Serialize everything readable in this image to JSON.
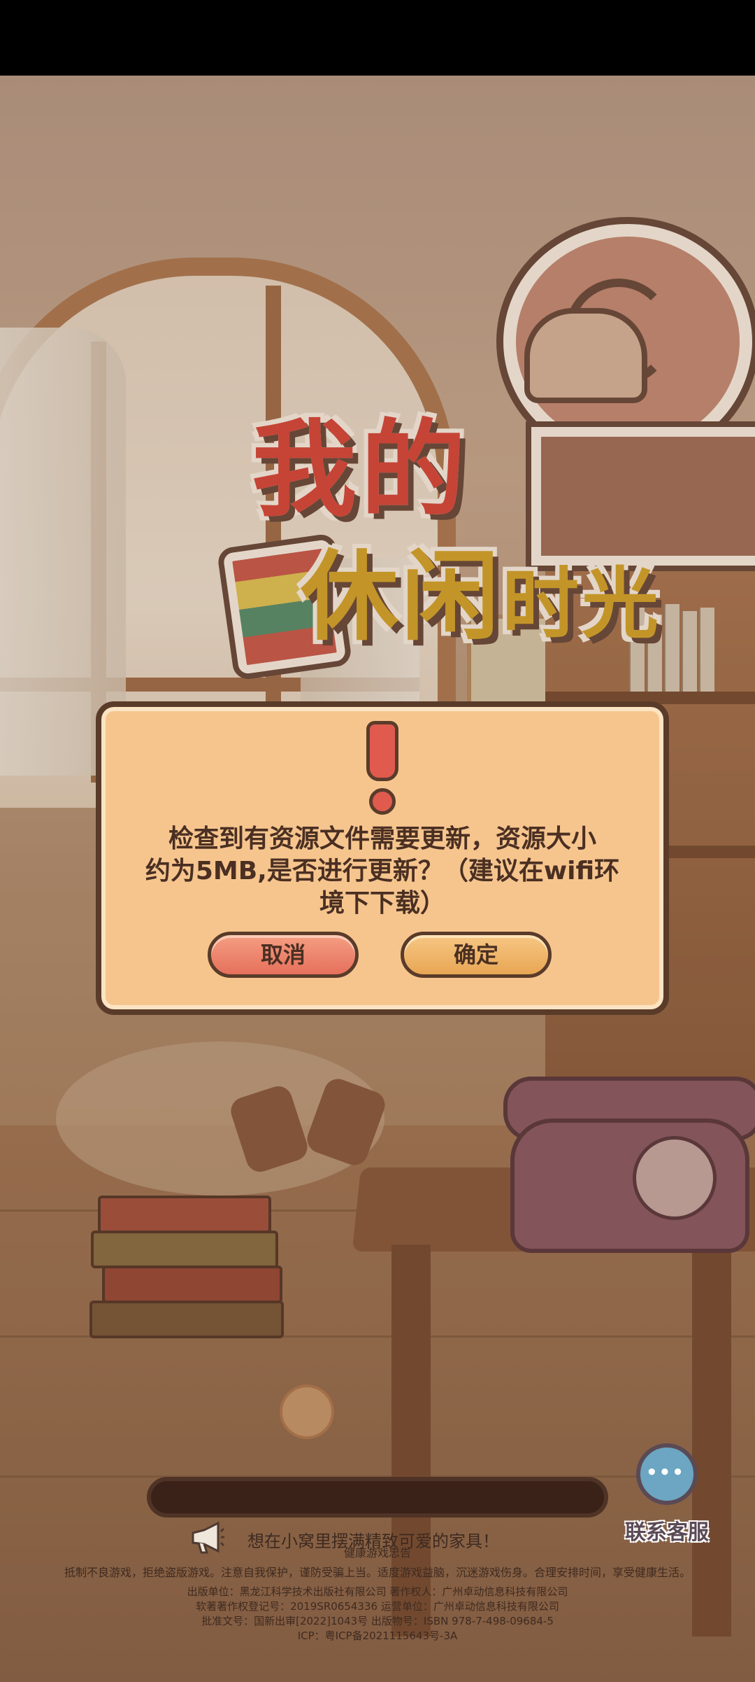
{
  "logo": {
    "line1": "我的",
    "line2a": "休闲",
    "line2b": "时光"
  },
  "dialog": {
    "message_line1": "检查到有资源文件需要更新，资源大小",
    "message_line2": "约为5MB,是否进行更新？（建议在wifi环",
    "message_line3": "境下下载）",
    "cancel_label": "取消",
    "ok_label": "确定",
    "icon": "exclamation-icon"
  },
  "loading": {
    "progress": 0.0,
    "tip": "想在小窝里摆满精致可爱的家具！",
    "tip_icon": "megaphone-icon"
  },
  "support": {
    "label": "联系客服",
    "icon": "customer-service-icon"
  },
  "footer": {
    "title": "健康游戏忠告",
    "advice": "抵制不良游戏，拒绝盗版游戏。注意自我保护，谨防受骗上当。适度游戏益脑，沉迷游戏伤身。合理安排时间，享受健康生活。",
    "publisher": "出版单位：黑龙江科学技术出版社有限公司    著作权人：广州卓动信息科技有限公司",
    "copyright": "软著著作权登记号：2019SR0654336    运营单位：广州卓动信息科技有限公司",
    "approval": "批准文号：国新出审[2022]1043号    出版物号：ISBN 978-7-498-09684-5",
    "icp": "ICP：粤ICP备2021115643号-3A"
  },
  "colors": {
    "dialog_bg": "#f6c58e",
    "cancel_btn": "#e6705c",
    "ok_btn": "#e8a654",
    "accent_red": "#e05a4e"
  }
}
